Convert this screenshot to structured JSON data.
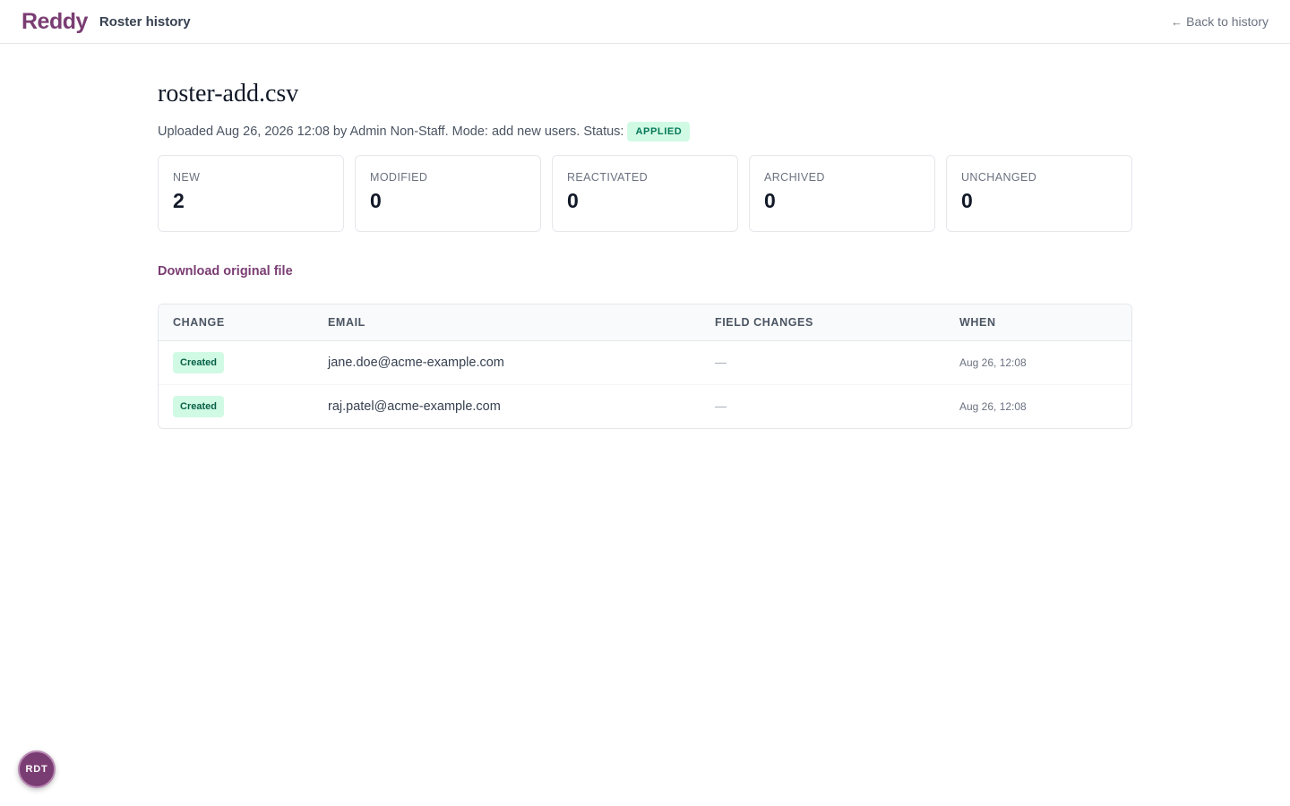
{
  "header": {
    "logo": "Reddy",
    "title": "Roster history",
    "back_arrow": "←",
    "back_label": "Back to history"
  },
  "page": {
    "title": "roster-add.csv",
    "meta_text": "Uploaded Aug 26, 2026 12:08 by Admin Non-Staff. Mode: add new users. Status:",
    "status": "APPLIED"
  },
  "stats": [
    {
      "label": "NEW",
      "value": "2"
    },
    {
      "label": "MODIFIED",
      "value": "0"
    },
    {
      "label": "REACTIVATED",
      "value": "0"
    },
    {
      "label": "ARCHIVED",
      "value": "0"
    },
    {
      "label": "UNCHANGED",
      "value": "0"
    }
  ],
  "download_label": "Download original file",
  "table": {
    "headers": [
      "CHANGE",
      "EMAIL",
      "FIELD CHANGES",
      "WHEN"
    ],
    "rows": [
      {
        "change": "Created",
        "email": "jane.doe@acme-example.com",
        "field_changes": "—",
        "when": "Aug 26, 12:08"
      },
      {
        "change": "Created",
        "email": "raj.patel@acme-example.com",
        "field_changes": "—",
        "when": "Aug 26, 12:08"
      }
    ]
  },
  "fab": {
    "initials": "RDT"
  },
  "colors": {
    "brand": "#7a3d73",
    "success_bg": "#d1fae5",
    "success_text": "#047857"
  }
}
